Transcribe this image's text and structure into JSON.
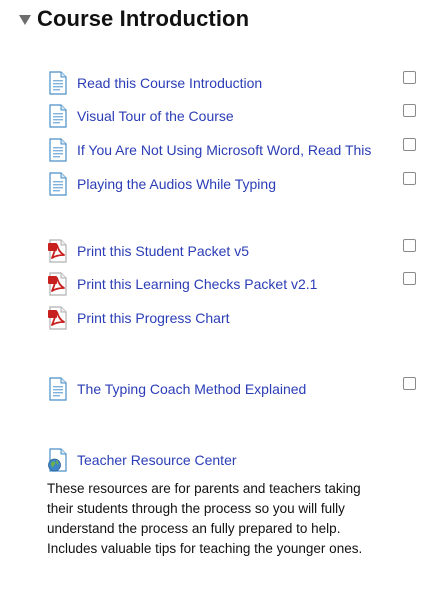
{
  "section": {
    "title": "Course Introduction"
  },
  "activities": [
    {
      "label": "Read this Course Introduction",
      "icon": "document-icon",
      "completion": true
    },
    {
      "label": "Visual Tour of the Course",
      "icon": "document-icon",
      "completion": true
    },
    {
      "label": "If You Are Not Using Microsoft Word, Read This",
      "icon": "document-icon",
      "completion": true
    },
    {
      "label": "Playing the Audios While Typing",
      "icon": "document-icon",
      "completion": true
    },
    {
      "label": "Print this Student Packet v5",
      "icon": "pdf-icon",
      "completion": true
    },
    {
      "label": "Print this Learning Checks Packet v2.1",
      "icon": "pdf-icon",
      "completion": true
    },
    {
      "label": "Print this Progress Chart",
      "icon": "pdf-icon",
      "completion": false
    },
    {
      "label": "The Typing Coach Method Explained",
      "icon": "document-icon",
      "completion": true
    },
    {
      "label": "Teacher Resource Center",
      "icon": "globe-url-icon",
      "completion": false
    }
  ],
  "resource_description": "These resources are for parents and teachers taking their students through the process so you will fully understand the process an fully prepared to help.  Includes valuable tips for teaching the younger ones.",
  "colors": {
    "link": "#2b3db6",
    "pdf_red": "#c8201e",
    "doc_blue": "#4a8fc7"
  }
}
